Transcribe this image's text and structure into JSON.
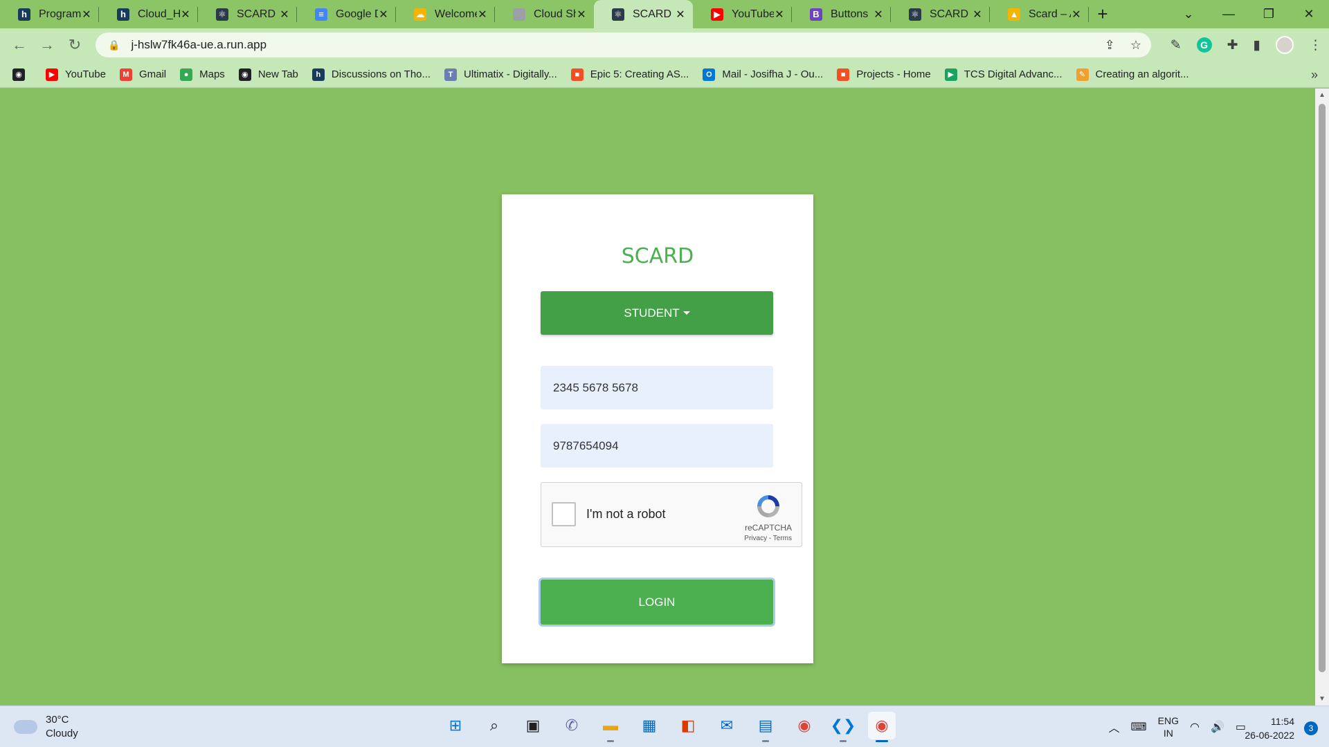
{
  "tabs": [
    {
      "title": "Programm",
      "fav": "h",
      "color": "#1a3a5c"
    },
    {
      "title": "Cloud_Ha",
      "fav": "h",
      "color": "#1a3a5c"
    },
    {
      "title": "SCARD",
      "fav": "⚛",
      "color": "#2a3a4a"
    },
    {
      "title": "Google D",
      "fav": "≡",
      "color": "#4285f4"
    },
    {
      "title": "Welcome",
      "fav": "☁",
      "color": "#f4b400"
    },
    {
      "title": "Cloud Sh",
      "fav": "",
      "color": "#9aa0a6"
    },
    {
      "title": "SCARD",
      "fav": "⚛",
      "color": "#2a3a4a"
    },
    {
      "title": "YouTube",
      "fav": "▶",
      "color": "#ff0000"
    },
    {
      "title": "Buttons",
      "fav": "B",
      "color": "#6f42c1"
    },
    {
      "title": "SCARD",
      "fav": "⚛",
      "color": "#2a3a4a"
    },
    {
      "title": "Scard – A",
      "fav": "▲",
      "color": "#f5b400"
    }
  ],
  "active_tab": 6,
  "address": {
    "url": "j-hslw7fk46a-ue.a.run.app"
  },
  "bookmarks": [
    {
      "label": "",
      "fav": "◉",
      "color": "#202124"
    },
    {
      "label": "YouTube",
      "fav": "▶",
      "color": "#ff0000"
    },
    {
      "label": "Gmail",
      "fav": "M",
      "color": "#ea4335"
    },
    {
      "label": "Maps",
      "fav": "●",
      "color": "#34a853"
    },
    {
      "label": "New Tab",
      "fav": "◉",
      "color": "#202124"
    },
    {
      "label": "Discussions on Tho...",
      "fav": "h",
      "color": "#1a3a5c"
    },
    {
      "label": "Ultimatix - Digitally...",
      "fav": "T",
      "color": "#6a7fb0"
    },
    {
      "label": "Epic 5: Creating AS...",
      "fav": "■",
      "color": "#f25022"
    },
    {
      "label": "Mail - Josifha J - Ou...",
      "fav": "O",
      "color": "#0078d4"
    },
    {
      "label": "Projects - Home",
      "fav": "■",
      "color": "#f25022"
    },
    {
      "label": "TCS Digital Advanc...",
      "fav": "▶",
      "color": "#1aa260"
    },
    {
      "label": "Creating an algorit...",
      "fav": "✎",
      "color": "#f0a030"
    }
  ],
  "card": {
    "brand": "SCARD",
    "role_label": "STUDENT",
    "field1_value": "2345 5678 5678",
    "field2_value": "9787654094",
    "captcha_label": "I'm not a robot",
    "captcha_brand": "reCAPTCHA",
    "captcha_links": "Privacy - Terms",
    "login_label": "LOGIN"
  },
  "taskbar": {
    "temp": "30°C",
    "condition": "Cloudy",
    "lang1": "ENG",
    "lang2": "IN",
    "time": "11:54",
    "date": "26-06-2022",
    "notifications": "3"
  },
  "colors": {
    "page_bg": "#87c061",
    "brand": "#4caf50",
    "role_btn": "#43a047"
  }
}
